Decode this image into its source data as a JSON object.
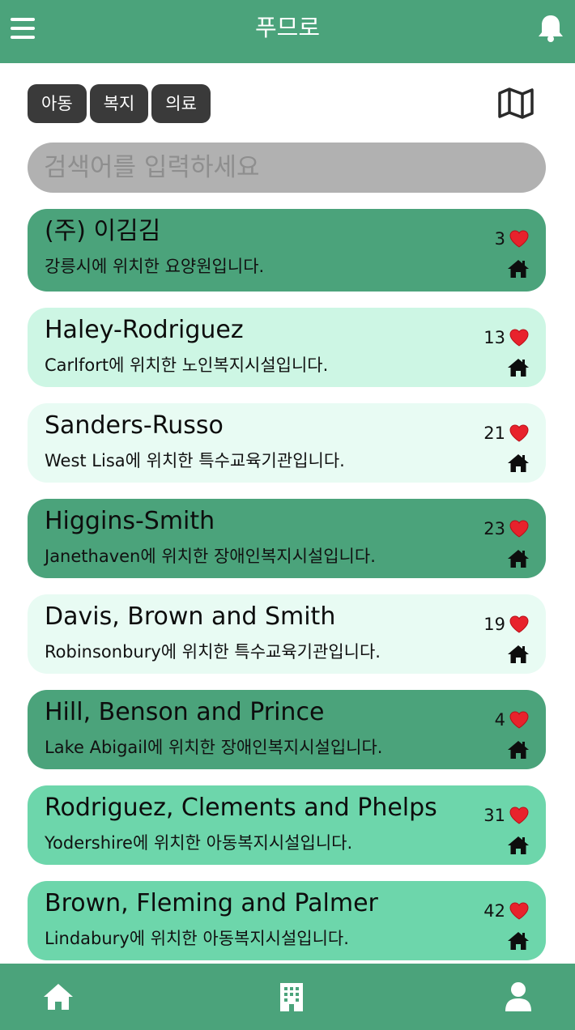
{
  "header": {
    "title": "푸므로",
    "menu_icon": "menu-icon",
    "notification_icon": "bell-icon"
  },
  "filters": {
    "chips": [
      {
        "label": "아동"
      },
      {
        "label": "복지"
      },
      {
        "label": "의료"
      }
    ],
    "map_icon": "map-icon"
  },
  "search": {
    "placeholder": "검색어를 입력하세요",
    "value": ""
  },
  "colors": {
    "primary": "#4ba37b",
    "card_dark": "#4ba37b",
    "card_mid": "#6dd6ab",
    "card_light": "#cdf6e4",
    "card_pale": "#e8fbf3",
    "chip": "#3a3a3a",
    "search_bg": "#b1b1b1",
    "heart": "#e8222c"
  },
  "facilities": [
    {
      "name": "(주) 이김김",
      "description": "강릉시에 위치한 요양원입니다.",
      "likes": "3",
      "color": "#4ba37b"
    },
    {
      "name": "Haley-Rodriguez",
      "description": "Carlfort에 위치한 노인복지시설입니다.",
      "likes": "13",
      "color": "#cdf6e4"
    },
    {
      "name": "Sanders-Russo",
      "description": "West Lisa에 위치한 특수교육기관입니다.",
      "likes": "21",
      "color": "#e8fbf3"
    },
    {
      "name": "Higgins-Smith",
      "description": "Janethaven에 위치한 장애인복지시설입니다.",
      "likes": "23",
      "color": "#4ba37b"
    },
    {
      "name": "Davis, Brown and Smith",
      "description": "Robinsonbury에 위치한 특수교육기관입니다.",
      "likes": "19",
      "color": "#e8fbf3"
    },
    {
      "name": "Hill, Benson and Prince",
      "description": "Lake Abigail에 위치한 장애인복지시설입니다.",
      "likes": "4",
      "color": "#4ba37b"
    },
    {
      "name": "Rodriguez, Clements and Phelps",
      "description": "Yodershire에 위치한 아동복지시설입니다.",
      "likes": "31",
      "color": "#6dd6ab"
    },
    {
      "name": "Brown, Fleming and Palmer",
      "description": "Lindabury에 위치한 아동복지시설입니다.",
      "likes": "42",
      "color": "#6dd6ab"
    }
  ],
  "bottom_nav": [
    {
      "icon": "home-icon"
    },
    {
      "icon": "building-icon"
    },
    {
      "icon": "user-icon"
    }
  ]
}
